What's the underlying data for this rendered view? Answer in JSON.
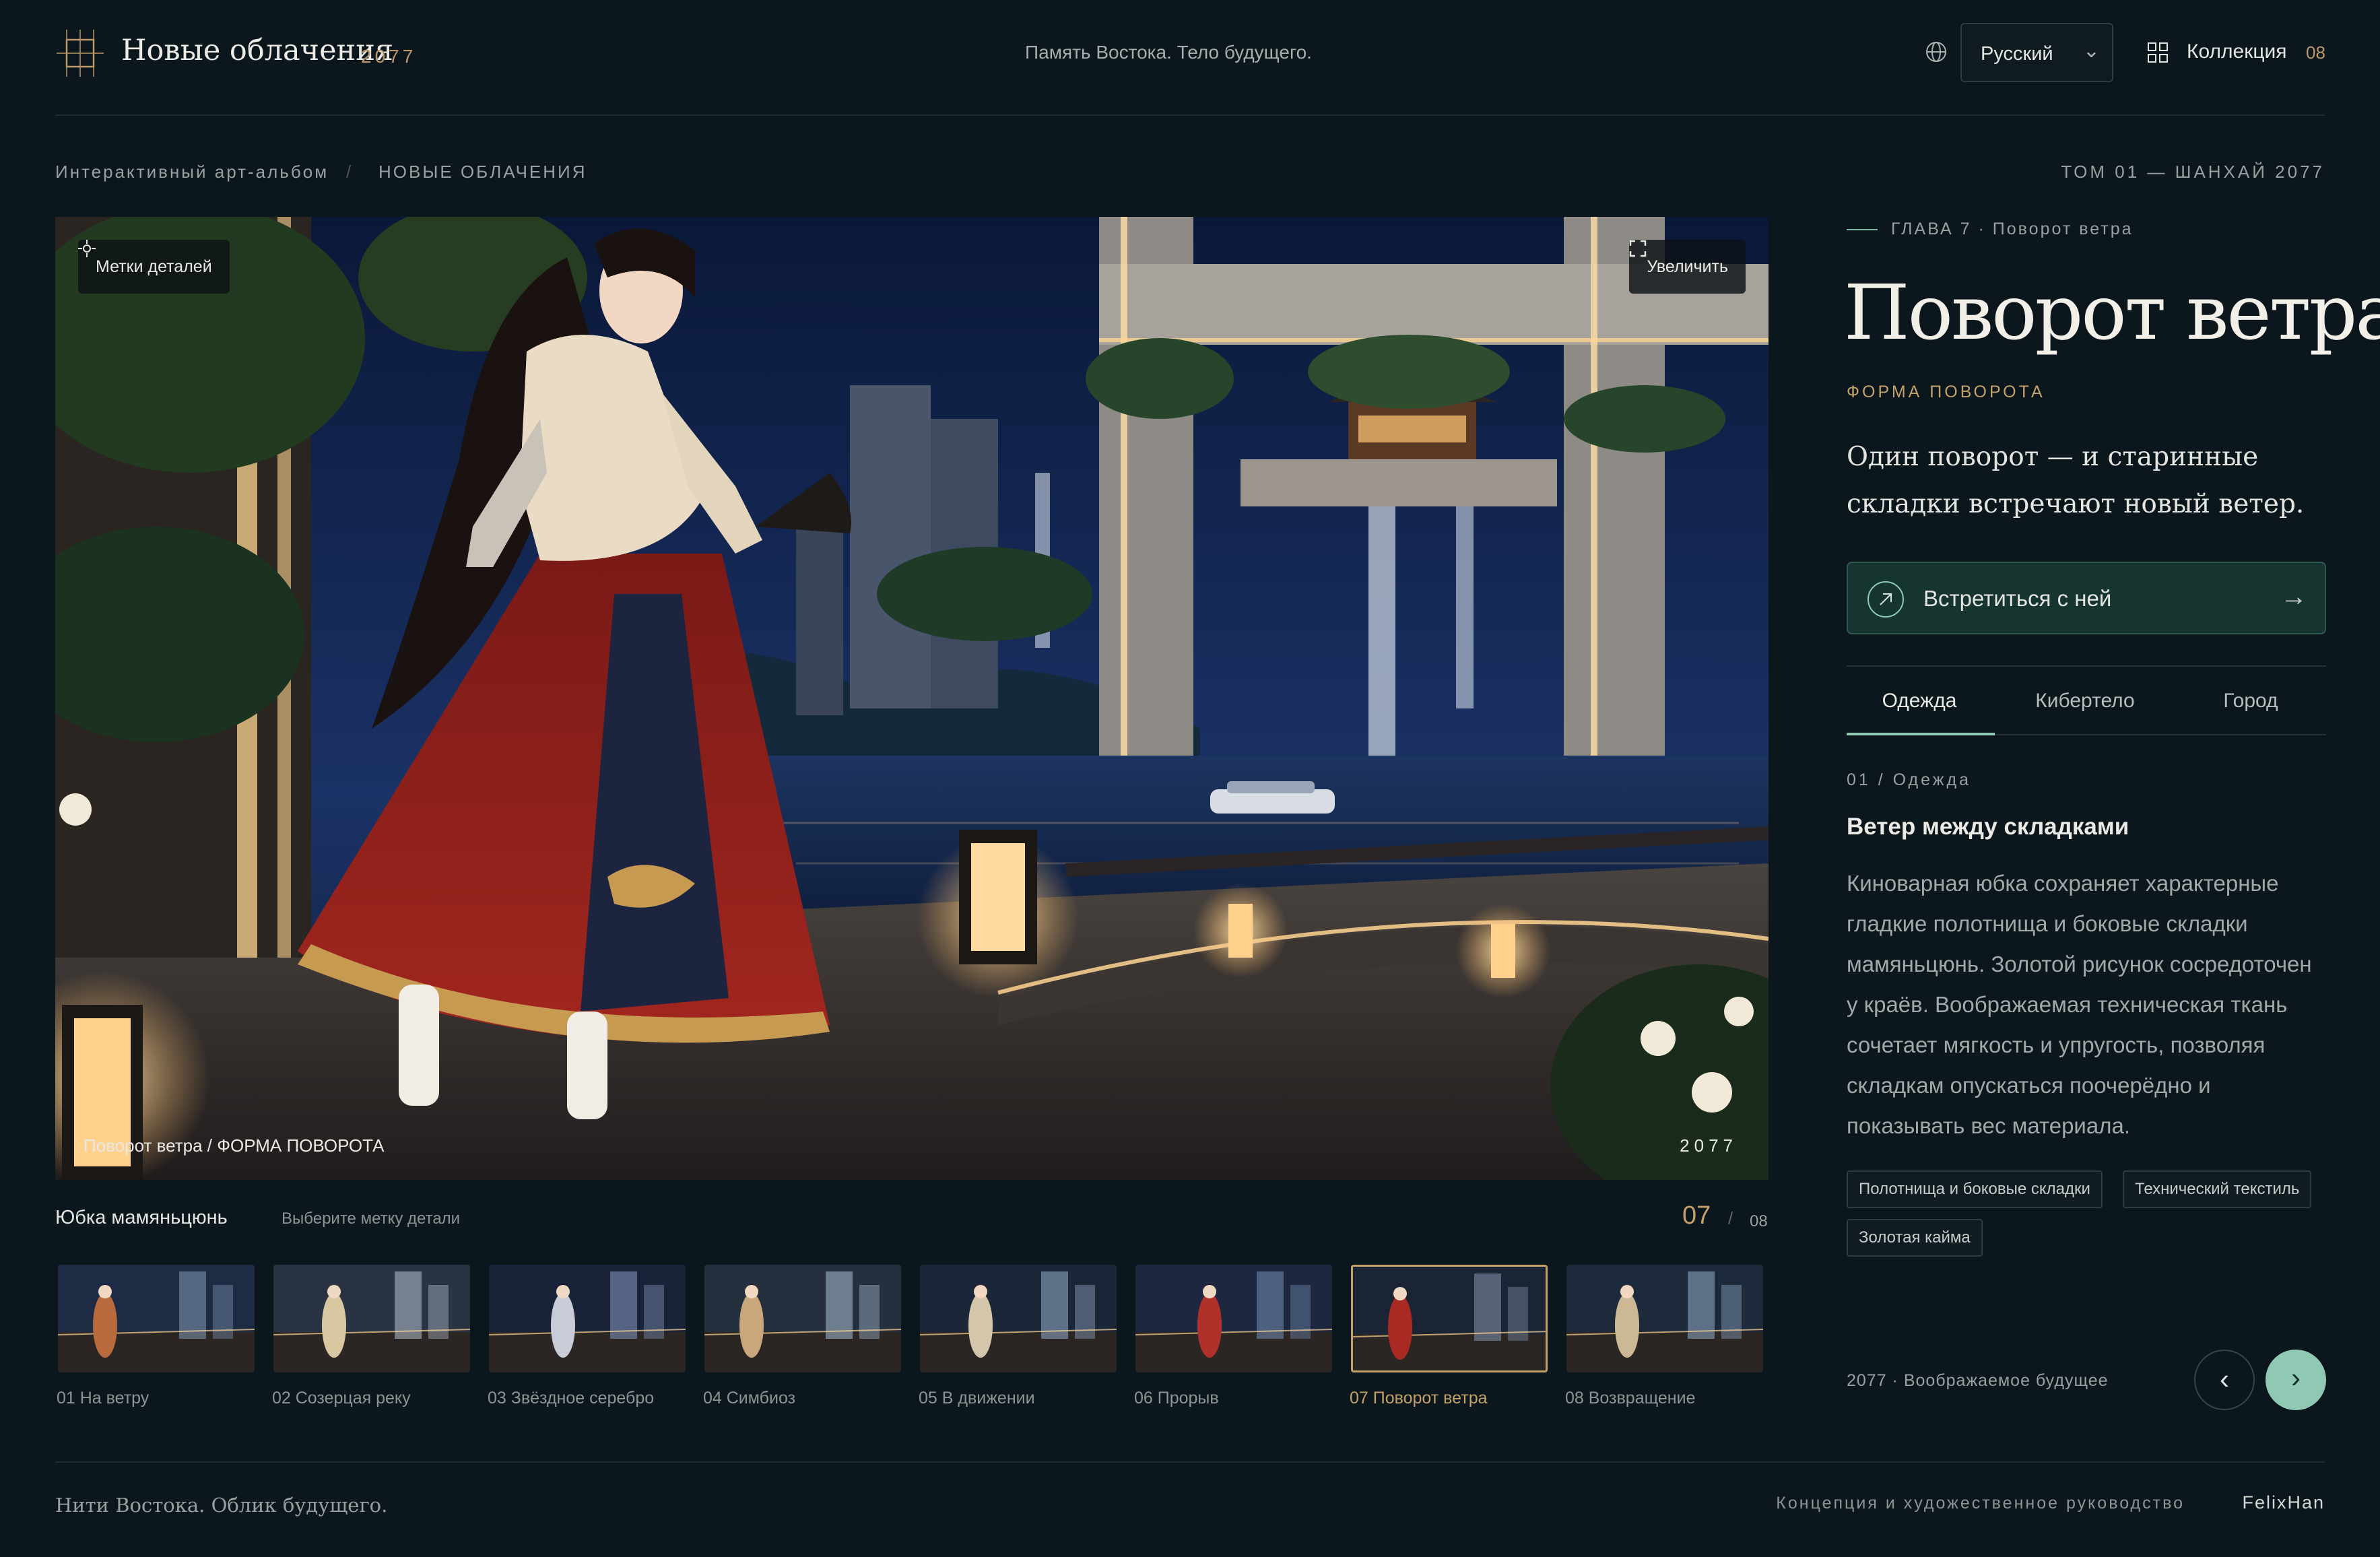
{
  "header": {
    "brand_title": "Новые облачения",
    "brand_year": "2077",
    "tagline": "Память Востока. Тело будущего.",
    "language": "Русский",
    "collection_label": "Коллекция",
    "collection_count": "08"
  },
  "breadcrumb": {
    "parent": "Интерактивный арт-альбом",
    "separator": "/",
    "current": "НОВЫЕ ОБЛАЧЕНИЯ",
    "volume": "ТОМ 01 — ШАНХАЙ 2077"
  },
  "hero": {
    "detail_marks_label": "Метки деталей",
    "zoom_label": "Увеличить",
    "caption": "Поворот ветра / ФОРМА ПОВОРОТА",
    "year": "2077"
  },
  "detail": {
    "part_name": "Юбка мамяньцюнь",
    "hint": "Выберите метку детали",
    "current": "07",
    "separator": "/",
    "total": "08"
  },
  "thumbnails": [
    {
      "label": "01 На ветру",
      "active": false
    },
    {
      "label": "02 Созерцая реку",
      "active": false
    },
    {
      "label": "03 Звёздное серебро",
      "active": false
    },
    {
      "label": "04 Симбиоз",
      "active": false
    },
    {
      "label": "05 В движении",
      "active": false
    },
    {
      "label": "06 Прорыв",
      "active": false
    },
    {
      "label": "07 Поворот ветра",
      "active": true
    },
    {
      "label": "08 Возвращение",
      "active": false
    }
  ],
  "panel": {
    "chapter": "ГЛАВА 7 · Поворот ветра",
    "title": "Поворот ветра",
    "subtitle": "ФОРМА ПОВОРОТА",
    "lead": "Один поворот — и старинные складки встречают новый ветер.",
    "cta_label": "Встретиться с ней",
    "tabs": [
      "Одежда",
      "Кибертело",
      "Город"
    ],
    "active_tab": "Одежда",
    "section_number": "01 / Одежда",
    "section_title": "Ветер между складками",
    "section_body": "Киноварная юбка сохраняет характерные гладкие полотнища и боковые складки мамяньцюнь. Золотой рисунок сосредоточен у краёв. Воображаемая техническая ткань сочетает мягкость и упругость, позволяя складкам опускаться поочерёдно и показывать вес материала.",
    "tags": [
      "Полотнища и боковые складки",
      "Технический текстиль",
      "Золотая кайма"
    ],
    "meta": "2077 · Воображаемое будущее"
  },
  "footer": {
    "left": "Нити Востока. Облик будущего.",
    "credit_label": "Концепция и художественное руководство",
    "author": "FelixHan"
  },
  "colors": {
    "background": "#0c171d",
    "accent_gold": "#c4a16a",
    "accent_mint": "#8fc9b3",
    "cta_bg": "#163530"
  },
  "icons": {
    "logo": "frame-cross-logo",
    "language": "globe-icon",
    "collection": "grid-icon",
    "detail_marks": "crosshair-icon",
    "zoom": "expand-icon",
    "cta": "arrow-up-right-icon"
  }
}
